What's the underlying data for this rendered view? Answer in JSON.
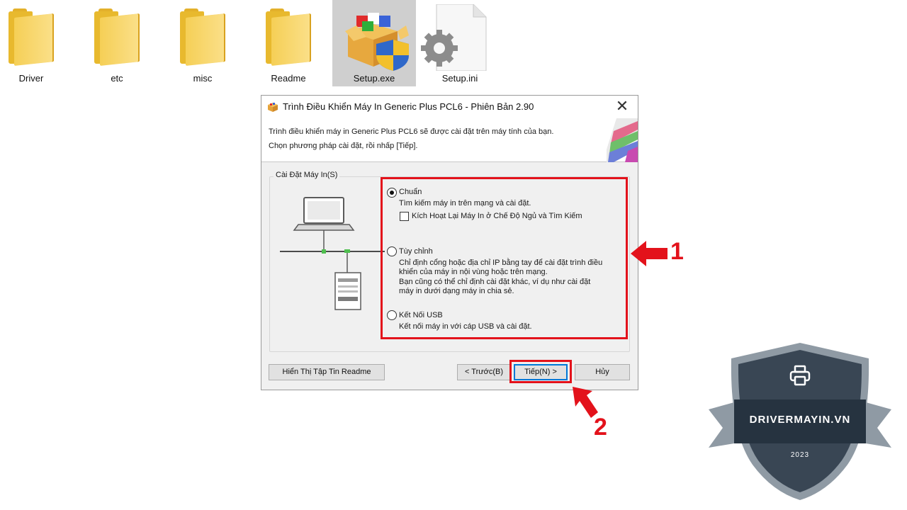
{
  "desktop": {
    "files": [
      {
        "name": "Driver",
        "icon": "folder-icon"
      },
      {
        "name": "etc",
        "icon": "folder-icon"
      },
      {
        "name": "misc",
        "icon": "folder-icon"
      },
      {
        "name": "Readme",
        "icon": "folder-icon"
      },
      {
        "name": "Setup.exe",
        "icon": "setup-exe-icon",
        "selected": true
      },
      {
        "name": "Setup.ini",
        "icon": "settings-file-icon"
      }
    ]
  },
  "dialog": {
    "title": "Trình Điều Khiển Máy In Generic Plus PCL6 - Phiên Bản 2.90",
    "close_glyph": "✕",
    "header_line1": "Trình điều khiển máy in Generic Plus PCL6 sẽ được cài đặt trên máy tính của bạn.",
    "header_line2": "Chọn phương pháp cài đặt, rồi nhấp [Tiếp].",
    "group_label": "Cài Đặt Máy In(S)",
    "options": {
      "standard": {
        "label": "Chuẩn",
        "desc": "Tìm kiếm máy in trên mạng và cài đặt.",
        "checkbox_label": "Kích Hoạt Lại Máy In ở Chế Độ Ngủ và Tìm Kiếm",
        "checked": false,
        "selected": true
      },
      "custom": {
        "label": "Tùy chỉnh",
        "desc1": "Chỉ định cổng hoặc địa chỉ IP bằng tay để cài đặt trình điều",
        "desc2": "khiển của máy in nội vùng hoặc trên mạng.",
        "desc3": "Bạn cũng có thể chỉ định cài đặt khác, ví dụ như cài đặt",
        "desc4": "máy in dưới dạng máy in chia sẻ.",
        "selected": false
      },
      "usb": {
        "label": "Kết Nối USB",
        "desc": "Kết nối máy in với cáp USB và cài đặt.",
        "selected": false
      }
    },
    "buttons": {
      "readme": "Hiển Thị Tập Tin Readme",
      "back": "< Trước(B)",
      "next": "Tiếp(N) >",
      "cancel": "Hủy"
    }
  },
  "annotations": {
    "marker1": "1",
    "marker2": "2",
    "color": "#e3121b"
  },
  "badge": {
    "brand": "DRIVERMAYIN.VN",
    "year": "2023",
    "icon": "printer-icon"
  }
}
